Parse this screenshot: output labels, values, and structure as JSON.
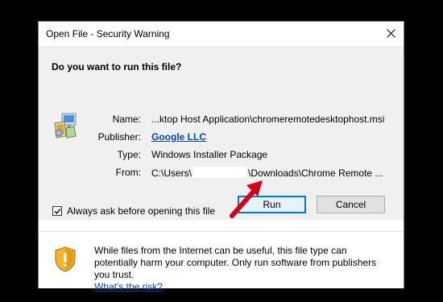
{
  "dialog": {
    "title": "Open File - Security Warning",
    "question": "Do you want to run this file?",
    "fields": {
      "name_label": "Name:",
      "name_value": "...ktop Host Application\\chromeremotedesktophost.msi",
      "publisher_label": "Publisher:",
      "publisher_value": "Google LLC",
      "type_label": "Type:",
      "type_value": "Windows Installer Package",
      "from_label": "From:",
      "from_value_start": "C:\\Users\\",
      "from_value_end": "\\Downloads\\Chrome Remote ..."
    },
    "run_label": "Run",
    "cancel_label": "Cancel",
    "checkbox_label": "Always ask before opening this file",
    "checkbox_checked": true,
    "warning_text": "While files from the Internet can be useful, this file type can potentially harm your computer. Only run software from publishers you trust.",
    "risk_link": "What's the risk?"
  },
  "colors": {
    "link": "#0645ad",
    "default_button_border": "#0078d7",
    "annotation_arrow": "#d0021b"
  },
  "icons": [
    "close-icon",
    "installer-package-icon",
    "security-shield-icon",
    "checkmark-icon",
    "annotation-arrow-icon"
  ]
}
